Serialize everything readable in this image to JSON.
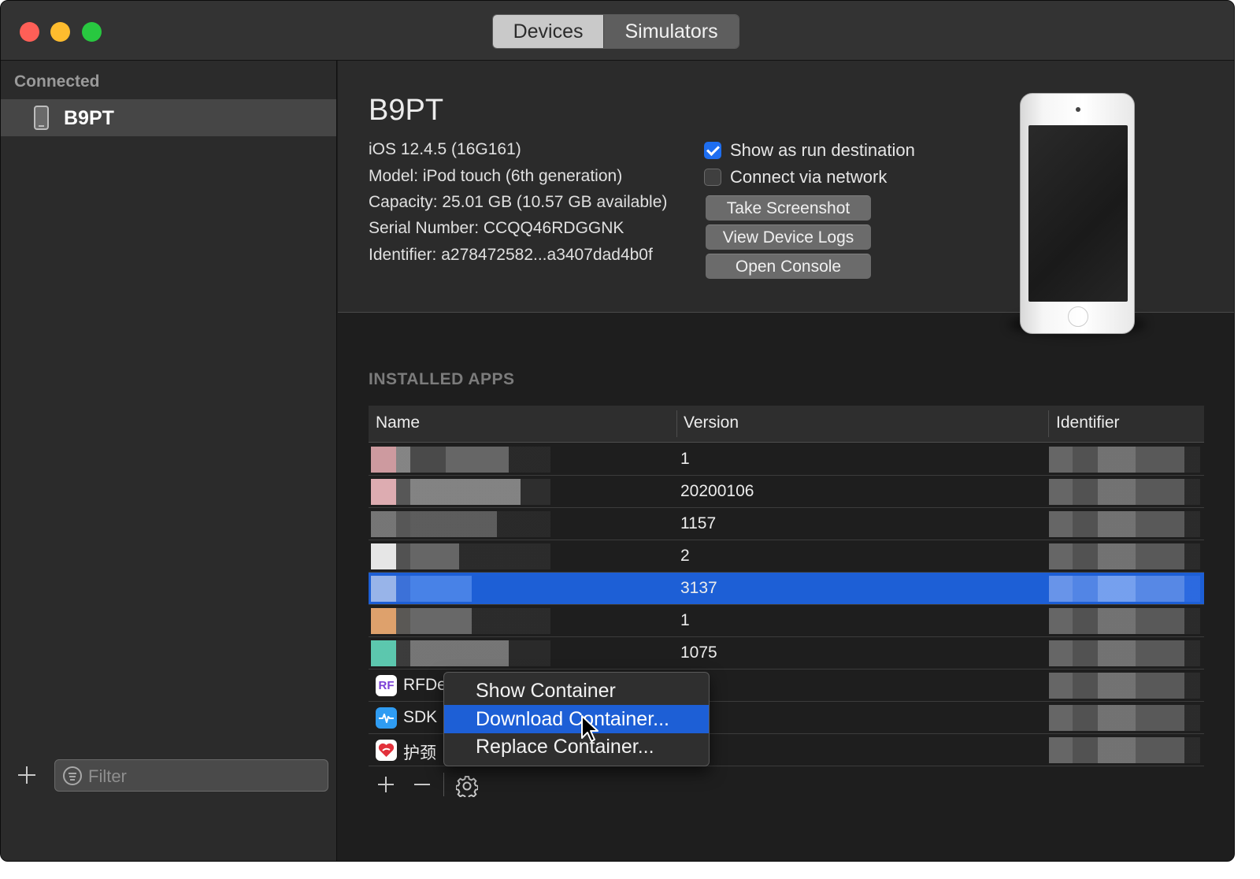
{
  "titlebar": {
    "tabs": [
      {
        "label": "Devices",
        "selected": true
      },
      {
        "label": "Simulators",
        "selected": false
      }
    ]
  },
  "sidebar": {
    "section_label": "Connected",
    "devices": [
      {
        "name": "B9PT",
        "icon": "ipod-icon",
        "selected": true
      }
    ],
    "filter_placeholder": "Filter"
  },
  "device": {
    "name": "B9PT",
    "os": "iOS 12.4.5 (16G161)",
    "model": "Model: iPod touch (6th generation)",
    "capacity": "Capacity: 25.01 GB (10.57 GB available)",
    "serial": "Serial Number: CCQQ46RDGGNK",
    "identifier": "Identifier: a278472582...a3407dad4b0f",
    "show_as_run_destination": {
      "label": "Show as run destination",
      "checked": true
    },
    "connect_via_network": {
      "label": "Connect via network",
      "checked": false
    },
    "buttons": {
      "take_screenshot": "Take Screenshot",
      "view_device_logs": "View Device Logs",
      "open_console": "Open Console"
    }
  },
  "installed_apps": {
    "heading": "INSTALLED APPS",
    "columns": {
      "name": "Name",
      "version": "Version",
      "identifier": "Identifier"
    },
    "rows": [
      {
        "name": "",
        "version": "1",
        "identifier": "",
        "blurred": true
      },
      {
        "name": "",
        "version": "20200106",
        "identifier": "",
        "blurred": true
      },
      {
        "name": "",
        "version": "1157",
        "identifier": "",
        "blurred": true
      },
      {
        "name": "",
        "version": "2",
        "identifier": "",
        "blurred": true
      },
      {
        "name": "",
        "version": "3137",
        "identifier": "",
        "blurred": true,
        "selected": true
      },
      {
        "name": "",
        "version": "1",
        "identifier": "",
        "blurred": true
      },
      {
        "name": "",
        "version": "1075",
        "identifier": "",
        "blurred": true
      },
      {
        "name": "RFDe",
        "icon_text": "RF",
        "version": "",
        "identifier": ""
      },
      {
        "name": "SDK",
        "icon_text": "",
        "version": "",
        "identifier": ""
      },
      {
        "name": "护颈",
        "icon_text": "",
        "version": "",
        "identifier": ""
      }
    ]
  },
  "context_menu": {
    "items": [
      {
        "label": "Show Container",
        "highlighted": false
      },
      {
        "label": "Download Container...",
        "highlighted": true
      },
      {
        "label": "Replace Container...",
        "highlighted": false
      }
    ]
  },
  "colors": {
    "accent": "#1d5fd6",
    "close": "#fe5f57",
    "minimize": "#febc2e",
    "zoom": "#28c840"
  }
}
